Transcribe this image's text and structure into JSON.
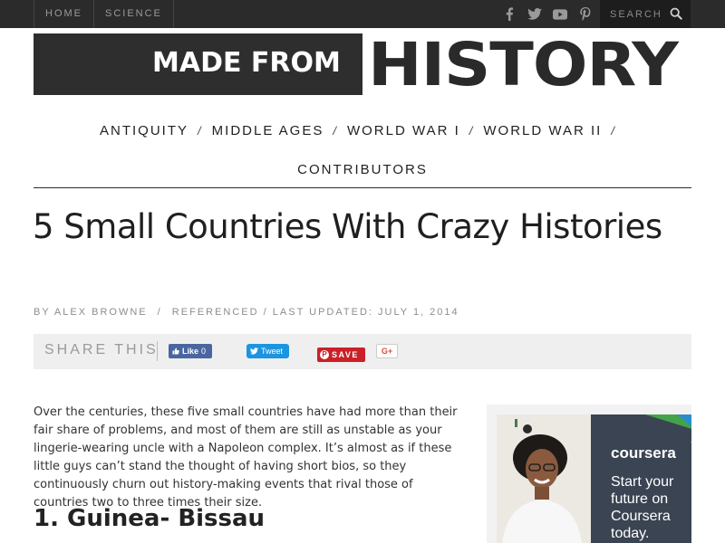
{
  "topbar": {
    "nav": [
      "HOME",
      "SCIENCE"
    ],
    "social_icons": [
      "facebook-icon",
      "twitter-icon",
      "youtube-icon",
      "pinterest-icon"
    ],
    "search_placeholder": "SEARCH"
  },
  "logo": {
    "part1": "MADE FROM",
    "part2": "HISTORY"
  },
  "mainnav": {
    "row1": [
      "ANTIQUITY",
      "MIDDLE AGES",
      "WORLD WAR I",
      "WORLD WAR II"
    ],
    "row2": [
      "CONTRIBUTORS"
    ],
    "separator": "/"
  },
  "article": {
    "title": "5 Small Countries With Crazy Histories",
    "meta": {
      "author": "BY ALEX BROWNE",
      "tag": "REFERENCED",
      "updated": "LAST UPDATED: JULY 1, 2014",
      "separator": "/"
    },
    "intro": "Over the centuries, these five small countries have had more than their fair share of problems, and most of them are still as unstable as your lingerie-wearing uncle with a Napoleon complex.  It’s almost as if these little guys can’t stand the thought of having short bios, so they continuously churn out history-making events that rival those of countries two to three times their size.",
    "section1_heading": "1. Guinea- Bissau"
  },
  "share": {
    "label": "SHARE THIS",
    "facebook": {
      "label": "Like",
      "count": "0"
    },
    "twitter": {
      "label": "Tweet"
    },
    "pinterest": {
      "label": "SAVE"
    },
    "googleplus": {
      "label": "G+"
    }
  },
  "ad": {
    "brand": "coursera",
    "copy": "Start your future on Coursera today."
  },
  "colors": {
    "topbar_bg": "#2b2b2b",
    "logo_box": "#2e2e2e",
    "facebook": "#4a66a0",
    "twitter": "#1b95e0",
    "pinterest": "#cb2027",
    "ad_panel": "#3a4452"
  }
}
